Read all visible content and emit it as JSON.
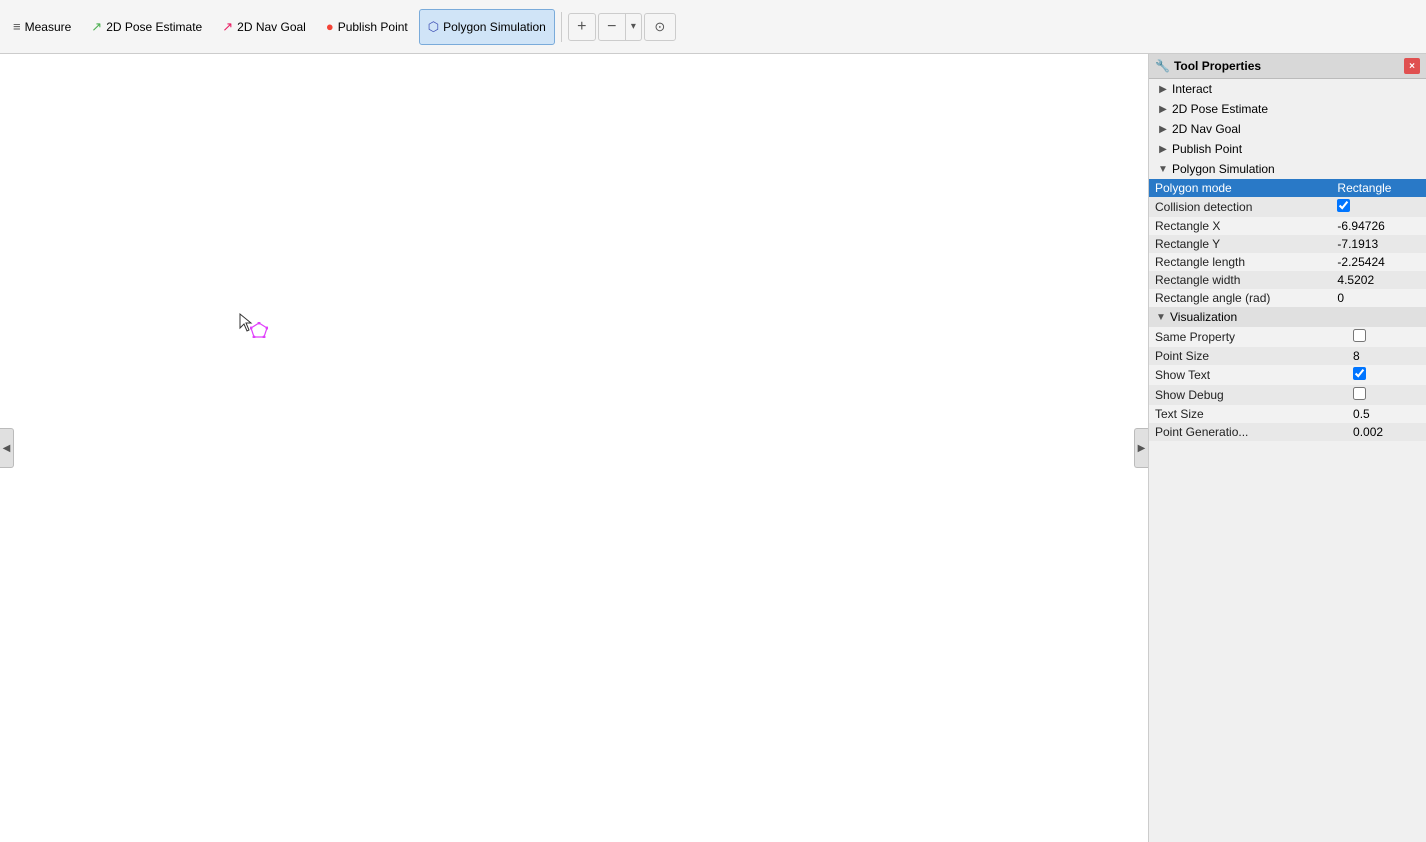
{
  "toolbar": {
    "tools": [
      {
        "id": "measure",
        "label": "Measure",
        "icon": "≡",
        "iconClass": "icon-measure",
        "active": false
      },
      {
        "id": "pose-estimate",
        "label": "2D Pose Estimate",
        "icon": "↗",
        "iconClass": "icon-pose",
        "active": false
      },
      {
        "id": "nav-goal",
        "label": "2D Nav Goal",
        "icon": "↗",
        "iconClass": "icon-navgoal",
        "active": false
      },
      {
        "id": "publish-point",
        "label": "Publish Point",
        "icon": "●",
        "iconClass": "icon-publish",
        "active": false
      },
      {
        "id": "polygon-sim",
        "label": "Polygon Simulation",
        "icon": "⬡",
        "iconClass": "icon-polygon",
        "active": true
      }
    ],
    "zoom_plus": "+",
    "zoom_minus": "−",
    "zoom_fit": "⊙"
  },
  "panel": {
    "title": "Tool Properties",
    "close_icon": "×",
    "tree_items": [
      {
        "id": "interact",
        "label": "Interact",
        "has_arrow": true,
        "expanded": false,
        "indent": 0
      },
      {
        "id": "pose-estimate",
        "label": "2D Pose Estimate",
        "has_arrow": true,
        "expanded": false,
        "indent": 0
      },
      {
        "id": "nav-goal",
        "label": "2D Nav Goal",
        "has_arrow": true,
        "expanded": false,
        "indent": 0
      },
      {
        "id": "publish-point",
        "label": "Publish Point",
        "has_arrow": true,
        "expanded": false,
        "indent": 0
      },
      {
        "id": "polygon-sim",
        "label": "Polygon Simulation",
        "has_arrow": true,
        "expanded": true,
        "indent": 0
      }
    ],
    "properties": [
      {
        "id": "polygon-mode",
        "name": "Polygon mode",
        "value": "Rectangle",
        "type": "text",
        "selected": true,
        "indent": 1
      },
      {
        "id": "collision-detection",
        "name": "Collision detection",
        "value": "",
        "type": "checkbox",
        "checked": true,
        "indent": 1
      },
      {
        "id": "rectangle-x",
        "name": "Rectangle X",
        "value": "-6.94726",
        "type": "text",
        "indent": 1
      },
      {
        "id": "rectangle-y",
        "name": "Rectangle Y",
        "value": "-7.1913",
        "type": "text",
        "indent": 1
      },
      {
        "id": "rectangle-length",
        "name": "Rectangle length",
        "value": "-2.25424",
        "type": "text",
        "indent": 1
      },
      {
        "id": "rectangle-width",
        "name": "Rectangle width",
        "value": "4.5202",
        "type": "text",
        "indent": 1
      },
      {
        "id": "rectangle-angle",
        "name": "Rectangle angle (rad)",
        "value": "0",
        "type": "text",
        "indent": 1
      }
    ],
    "visualization": {
      "label": "Visualization",
      "items": [
        {
          "id": "same-property",
          "name": "Same Property",
          "value": "",
          "type": "checkbox",
          "checked": false,
          "indent": 2
        },
        {
          "id": "point-size",
          "name": "Point Size",
          "value": "8",
          "type": "text",
          "indent": 2
        },
        {
          "id": "show-text",
          "name": "Show Text",
          "value": "",
          "type": "checkbox",
          "checked": true,
          "indent": 2
        },
        {
          "id": "show-debug",
          "name": "Show Debug",
          "value": "",
          "type": "checkbox",
          "checked": false,
          "indent": 2
        },
        {
          "id": "text-size",
          "name": "Text Size",
          "value": "0.5",
          "type": "text",
          "indent": 2
        },
        {
          "id": "point-generation",
          "name": "Point Generatio...",
          "value": "0.002",
          "type": "text",
          "indent": 2
        }
      ]
    }
  },
  "canvas": {
    "left_handle": "◀",
    "right_handle": "▶"
  }
}
